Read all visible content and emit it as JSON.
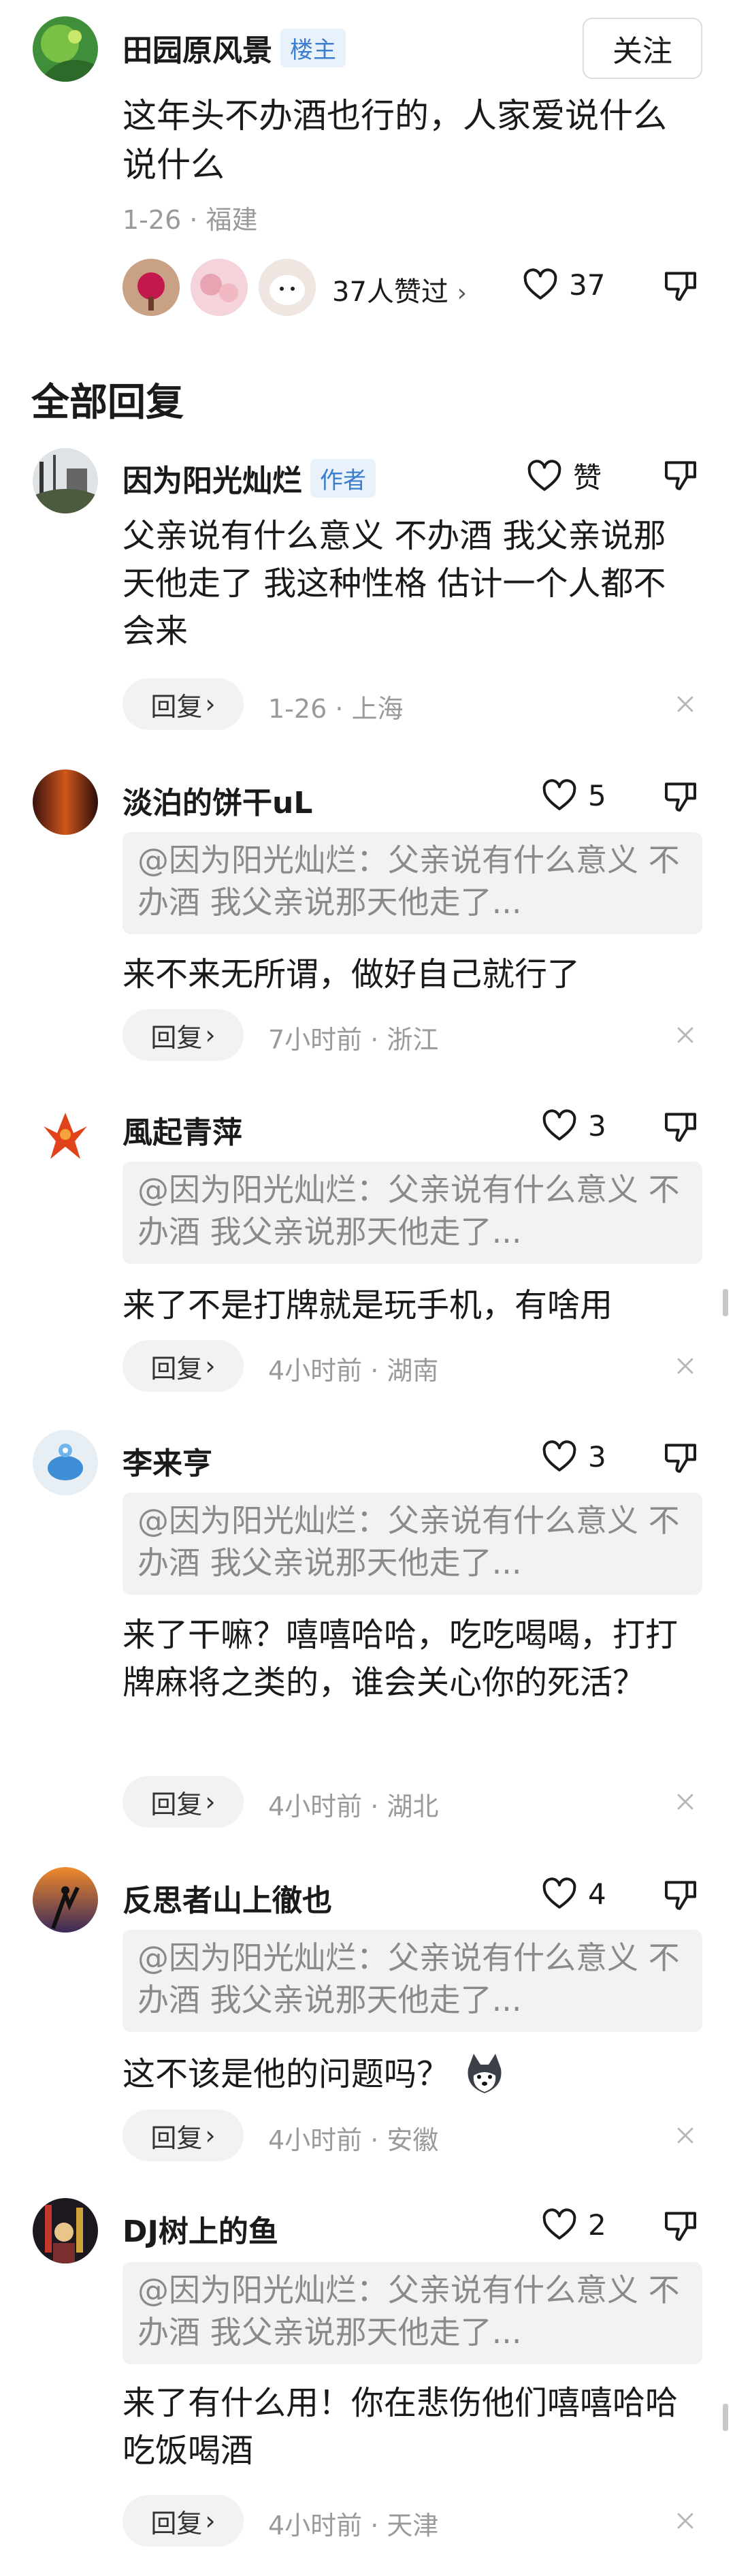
{
  "top_post": {
    "username": "田园原风景",
    "badge": "楼主",
    "follow_label": "关注",
    "text": "这年头不办酒也行的，人家爱说什么说什么",
    "meta": "1-26 · 福建",
    "likers_text": "37人赞过",
    "like_count": "37"
  },
  "section_title": "全部回复",
  "replies": [
    {
      "username": "因为阳光灿烂",
      "badge": "作者",
      "like": "赞",
      "quote": "",
      "text": "父亲说有什么意义 不办酒 我父亲说那天他走了 我这种性格 估计一个人都不会来",
      "reply_label": "回复",
      "meta": "1-26 · 上海"
    },
    {
      "username": "淡泊的饼干uL",
      "like": "5",
      "quote": "@因为阳光灿烂：父亲说有什么意义 不办酒 我父亲说那天他走了...",
      "text": "来不来无所谓，做好自己就行了",
      "reply_label": "回复",
      "meta": "7小时前 · 浙江"
    },
    {
      "username": "風起青萍",
      "like": "3",
      "quote": "@因为阳光灿烂：父亲说有什么意义 不办酒 我父亲说那天他走了...",
      "text": "来了不是打牌就是玩手机，有啥用",
      "reply_label": "回复",
      "meta": "4小时前 · 湖南"
    },
    {
      "username": "李来亨",
      "like": "3",
      "quote": "@因为阳光灿烂：父亲说有什么意义 不办酒 我父亲说那天他走了...",
      "text": "来了干嘛？嘻嘻哈哈，吃吃喝喝，打打牌麻将之类的，谁会关心你的死活？",
      "reply_label": "回复",
      "meta": "4小时前 · 湖北"
    },
    {
      "username": "反思者山上徹也",
      "like": "4",
      "quote": "@因为阳光灿烂：父亲说有什么意义 不办酒 我父亲说那天他走了...",
      "text": "这不该是他的问题吗？",
      "reply_label": "回复",
      "meta": "4小时前 · 安徽"
    },
    {
      "username": "DJ树上的鱼",
      "like": "2",
      "quote": "@因为阳光灿烂：父亲说有什么意义 不办酒 我父亲说那天他走了...",
      "text": "来了有什么用！你在悲伤他们嘻嘻哈哈吃饭喝酒",
      "reply_label": "回复",
      "meta": "4小时前 · 天津"
    }
  ],
  "colors": {
    "accent_blue": "#3b7ed0",
    "quote_bg": "#f1f2f4",
    "meta_gray": "#9a9a9a"
  }
}
